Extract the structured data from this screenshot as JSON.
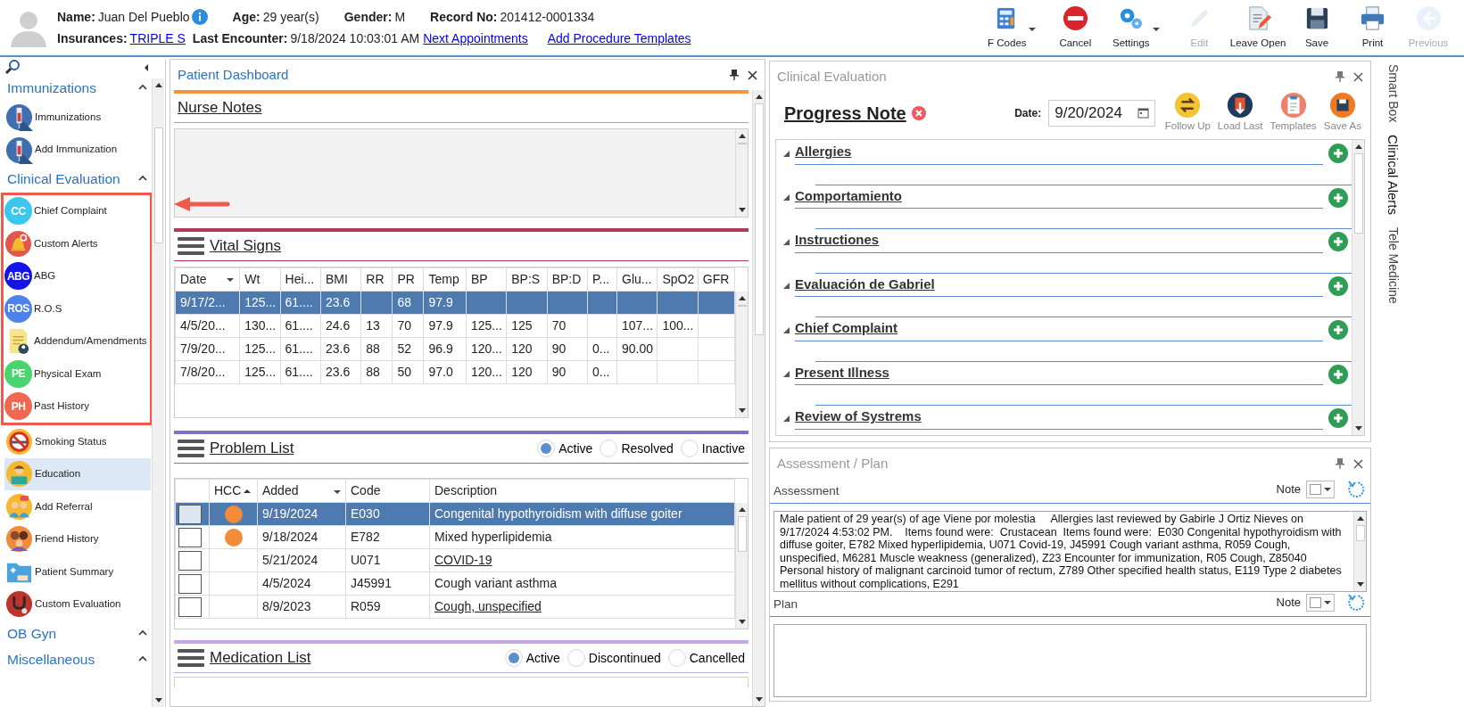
{
  "header": {
    "line_1": [
      {
        "label": "Name:",
        "value": "Juan Del Pueblo",
        "info_icon": true
      },
      {
        "label": "Age:",
        "value": "29 year(s)",
        "info_icon": false
      },
      {
        "label": "Gender:",
        "value": "M",
        "info_icon": false
      },
      {
        "label": "Record No:",
        "value": "201412-0001334",
        "info_icon": false
      }
    ],
    "line_2": [
      {
        "label": "Insurances:",
        "value": "TRIPLE S",
        "link": true
      },
      {
        "label": "Last Encounter:",
        "value": "9/18/2024 10:03:01 AM",
        "link": false
      }
    ],
    "links": [
      "Next Appointments",
      "Add Procedure Templates"
    ]
  },
  "toolbar": [
    {
      "label": "F Codes",
      "kind": "calculator",
      "dropdown": true,
      "disabled": false
    },
    {
      "label": "Cancel",
      "kind": "stop",
      "dropdown": false,
      "disabled": false
    },
    {
      "label": "Settings",
      "kind": "gear",
      "dropdown": true,
      "disabled": false
    },
    {
      "label": "Edit",
      "kind": "pencil",
      "dropdown": false,
      "disabled": true
    },
    {
      "label": "Leave Open",
      "kind": "document",
      "dropdown": false,
      "disabled": false
    },
    {
      "label": "Save",
      "kind": "save",
      "dropdown": false,
      "disabled": false
    },
    {
      "label": "Print",
      "kind": "printer",
      "dropdown": false,
      "disabled": false
    },
    {
      "label": "Previous",
      "kind": "back",
      "dropdown": false,
      "disabled": true
    }
  ],
  "sidebar": {
    "groups": [
      {
        "title": "Immunizations",
        "items": [
          {
            "label": "Immunizations",
            "kind": "syringe",
            "selected": false,
            "highlighted": false
          },
          {
            "label": "Add Immunization",
            "kind": "syringe",
            "selected": false,
            "highlighted": false
          }
        ]
      },
      {
        "title": "Clinical Evaluation",
        "items": [
          {
            "label": "Chief Complaint",
            "kind": "initials",
            "initials": "CC",
            "color": "#3cc8ee",
            "selected": false,
            "highlighted": true
          },
          {
            "label": "Custom Alerts",
            "kind": "bell",
            "selected": false,
            "highlighted": true
          },
          {
            "label": "ABG",
            "kind": "initials",
            "initials": "ABG",
            "color": "#1414e6",
            "selected": false,
            "highlighted": true
          },
          {
            "label": "R.O.S",
            "kind": "initials",
            "initials": "ROS",
            "color": "#4d82e8",
            "selected": false,
            "highlighted": true
          },
          {
            "label": "Addendum/Amendments",
            "kind": "note",
            "selected": false,
            "highlighted": true
          },
          {
            "label": "Physical Exam",
            "kind": "initials",
            "initials": "PE",
            "color": "#47d66e",
            "selected": false,
            "highlighted": true
          },
          {
            "label": "Past History",
            "kind": "initials",
            "initials": "PH",
            "color": "#f0684f",
            "selected": false,
            "highlighted": true
          },
          {
            "label": "Smoking Status",
            "kind": "nosmoking",
            "selected": false,
            "highlighted": false
          },
          {
            "label": "Education",
            "kind": "reader",
            "selected": true,
            "highlighted": false
          },
          {
            "label": "Add Referral",
            "kind": "people",
            "selected": false,
            "highlighted": false
          },
          {
            "label": "Friend History",
            "kind": "family",
            "selected": false,
            "highlighted": false
          },
          {
            "label": "Patient Summary",
            "kind": "folder",
            "selected": false,
            "highlighted": false
          },
          {
            "label": "Custom Evaluation",
            "kind": "stethoscope",
            "selected": false,
            "highlighted": false
          }
        ]
      },
      {
        "title": "OB Gyn"
      },
      {
        "title": "Miscellaneous"
      }
    ]
  },
  "dashboard": {
    "title": "Patient Dashboard",
    "nurse_notes": {
      "title": "Nurse Notes"
    },
    "vital_signs": {
      "title": "Vital Signs",
      "columns": [
        {
          "label": "Date",
          "menu": true
        },
        {
          "label": "Wt",
          "menu": false
        },
        {
          "label": "Hei...",
          "menu": false
        },
        {
          "label": "BMI",
          "menu": false
        },
        {
          "label": "RR",
          "menu": false
        },
        {
          "label": "PR",
          "menu": false
        },
        {
          "label": "Temp",
          "menu": false
        },
        {
          "label": "BP",
          "menu": false
        },
        {
          "label": "BP:S",
          "menu": false
        },
        {
          "label": "BP:D",
          "menu": false
        },
        {
          "label": "P...",
          "menu": false
        },
        {
          "label": "Glu...",
          "menu": false
        },
        {
          "label": "SpO2",
          "menu": false
        },
        {
          "label": "GFR",
          "menu": false
        }
      ],
      "rows": [
        {
          "selected": true,
          "cells": [
            "9/17/2...",
            "125...",
            "61....",
            "23.6",
            "",
            "68",
            "97.9",
            "",
            "",
            "",
            "",
            "",
            "",
            ""
          ]
        },
        {
          "selected": false,
          "cells": [
            "4/5/20...",
            "130...",
            "61....",
            "24.6",
            "13",
            "70",
            "97.9",
            "125...",
            "125",
            "70",
            "",
            "107...",
            "100...",
            ""
          ]
        },
        {
          "selected": false,
          "cells": [
            "7/9/20...",
            "125...",
            "61....",
            "23.6",
            "88",
            "52",
            "96.9",
            "120...",
            "120",
            "90",
            "0...",
            "90.00",
            "",
            ""
          ]
        },
        {
          "selected": false,
          "cells": [
            "7/8/20...",
            "125...",
            "61....",
            "23.6",
            "88",
            "50",
            "97.0",
            "120...",
            "120",
            "90",
            "0...",
            "",
            "",
            ""
          ]
        }
      ]
    },
    "problem_list": {
      "title": "Problem List",
      "filters": [
        {
          "label": "Active",
          "selected": true
        },
        {
          "label": "Resolved",
          "selected": false
        },
        {
          "label": "Inactive",
          "selected": false
        }
      ],
      "columns": [
        {
          "label": "HCC",
          "sorted_ascending": true,
          "menu": false
        },
        {
          "label": "Added",
          "sorted_ascending": false,
          "menu": true
        },
        {
          "label": "Code",
          "sorted_ascending": false,
          "menu": false
        },
        {
          "label": "Description",
          "sorted_ascending": false,
          "menu": false
        }
      ],
      "rows": [
        {
          "selected": true,
          "checked": false,
          "hcc": true,
          "added": "9/19/2024",
          "code": "E030",
          "description": "Congenital hypothyroidism with diffuse goiter",
          "link": false
        },
        {
          "selected": false,
          "checked": false,
          "hcc": true,
          "added": "9/18/2024",
          "code": "E782",
          "description": "Mixed hyperlipidemia",
          "link": false
        },
        {
          "selected": false,
          "checked": false,
          "hcc": false,
          "added": "5/21/2024",
          "code": "U071",
          "description": "COVID-19",
          "link": true
        },
        {
          "selected": false,
          "checked": false,
          "hcc": false,
          "added": "4/5/2024",
          "code": "J45991",
          "description": "Cough variant asthma",
          "link": false
        },
        {
          "selected": false,
          "checked": false,
          "hcc": false,
          "added": "8/9/2023",
          "code": "R059",
          "description": "Cough, unspecified",
          "link": true
        }
      ]
    },
    "medication_list": {
      "title": "Medication List",
      "filters": [
        {
          "label": "Active",
          "selected": true
        },
        {
          "label": "Discontinued",
          "selected": false
        },
        {
          "label": "Cancelled",
          "selected": false
        }
      ]
    }
  },
  "clinical_evaluation": {
    "title": "Clinical Evaluation",
    "note_title": "Progress Note",
    "date_label": "Date:",
    "date": "9/20/2024",
    "actions": [
      {
        "label": "Follow Up",
        "kind": "swap"
      },
      {
        "label": "Load Last",
        "kind": "load"
      },
      {
        "label": "Templates",
        "kind": "clipboard"
      },
      {
        "label": "Save As",
        "kind": "save"
      }
    ],
    "sections": [
      "Allergies",
      "Comportamiento",
      "Instructiones",
      "Evaluación de Gabriel",
      "Chief Complaint",
      "Present Illness",
      "Review of Systrems"
    ]
  },
  "assessment_plan": {
    "title": "Assessment / Plan",
    "assessment": {
      "label": "Assessment",
      "note_label": "Note",
      "text": "Male patient of 29 year(s) of age Viene por molestia     Allergies last reviewed by Gabirle J Ortiz Nieves on 9/17/2024 4:53:02 PM.    Items found were:  Crustacean  Items found were:  E030 Congenital hypothyroidism with diffuse goiter, E782 Mixed hyperlipidemia, U071 Covid-19, J45991 Cough variant asthma, R059 Cough, unspecified, M6281 Muscle weakness (generalized), Z23 Encounter for immunization, R05 Cough, Z85040 Personal history of malignant carcinoid tumor of rectum, Z789 Other specified health status, E119 Type 2 diabetes mellitus without complications, E291"
    },
    "plan": {
      "label": "Plan",
      "note_label": "Note"
    }
  },
  "side_tabs": [
    {
      "label": "Smart Box",
      "selected": false
    },
    {
      "label": "Clinical Alerts",
      "selected": true
    },
    {
      "label": "Tele Medicine",
      "selected": false
    }
  ]
}
